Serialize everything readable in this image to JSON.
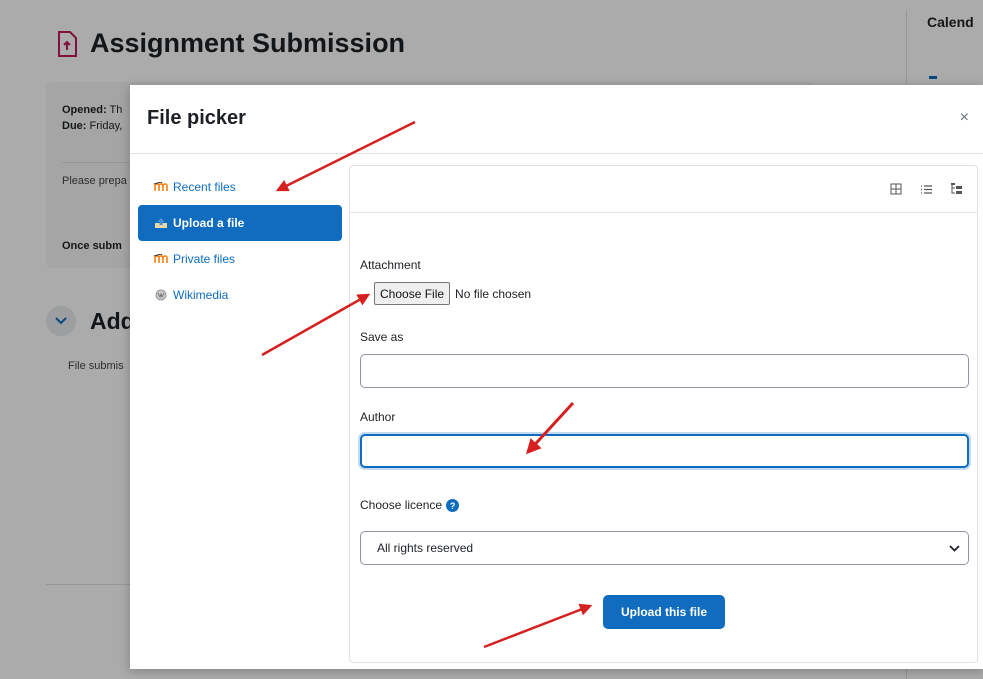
{
  "background": {
    "title": "Assignment Submission",
    "opened_label": "Opened:",
    "opened_value": " Th",
    "due_label": "Due:",
    "due_value": " Friday,",
    "instruction_text": "Please prepa",
    "once_text": "Once subm",
    "section_title": "Add",
    "file_submissions_text": "File submis",
    "right_block_title": "Calend"
  },
  "modal": {
    "title": "File picker",
    "close_glyph": "×"
  },
  "repositories": [
    {
      "label": "Recent files",
      "icon": "moodle-icon",
      "active": false
    },
    {
      "label": "Upload a file",
      "icon": "upload-icon",
      "active": true
    },
    {
      "label": "Private files",
      "icon": "moodle-icon",
      "active": false
    },
    {
      "label": "Wikimedia",
      "icon": "wikimedia-icon",
      "active": false
    }
  ],
  "view_toggles": [
    "grid-view-icon",
    "list-view-icon",
    "tree-view-icon"
  ],
  "form": {
    "attachment_label": "Attachment",
    "choose_file_button": "Choose File",
    "no_file_text": "No file chosen",
    "save_as_label": "Save as",
    "save_as_value": "",
    "author_label": "Author",
    "author_value": "",
    "licence_label": "Choose licence",
    "licence_selected": "All rights reserved",
    "upload_button": "Upload this file"
  },
  "colors": {
    "accent": "#0f6cbf",
    "arrow": "#d62020",
    "assign_icon": "#c2185b"
  }
}
